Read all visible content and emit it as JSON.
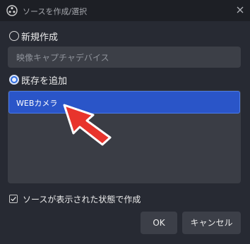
{
  "window": {
    "title": "ソースを作成/選択",
    "icon": "obs-logo-icon",
    "close_icon": "close-icon"
  },
  "options": {
    "create_new_label": "新規作成",
    "create_new_selected": false,
    "name_value": "映像キャプチャデバイス",
    "add_existing_label": "既存を追加",
    "add_existing_selected": true
  },
  "existing_list": [
    {
      "label": "WEBカメラ",
      "selected": true
    }
  ],
  "annotation": {
    "type": "arrow",
    "color": "#e8342c"
  },
  "visible_checkbox": {
    "label": "ソースが表示された状態で作成",
    "checked": true
  },
  "buttons": {
    "ok": "OK",
    "cancel": "キャンセル"
  }
}
